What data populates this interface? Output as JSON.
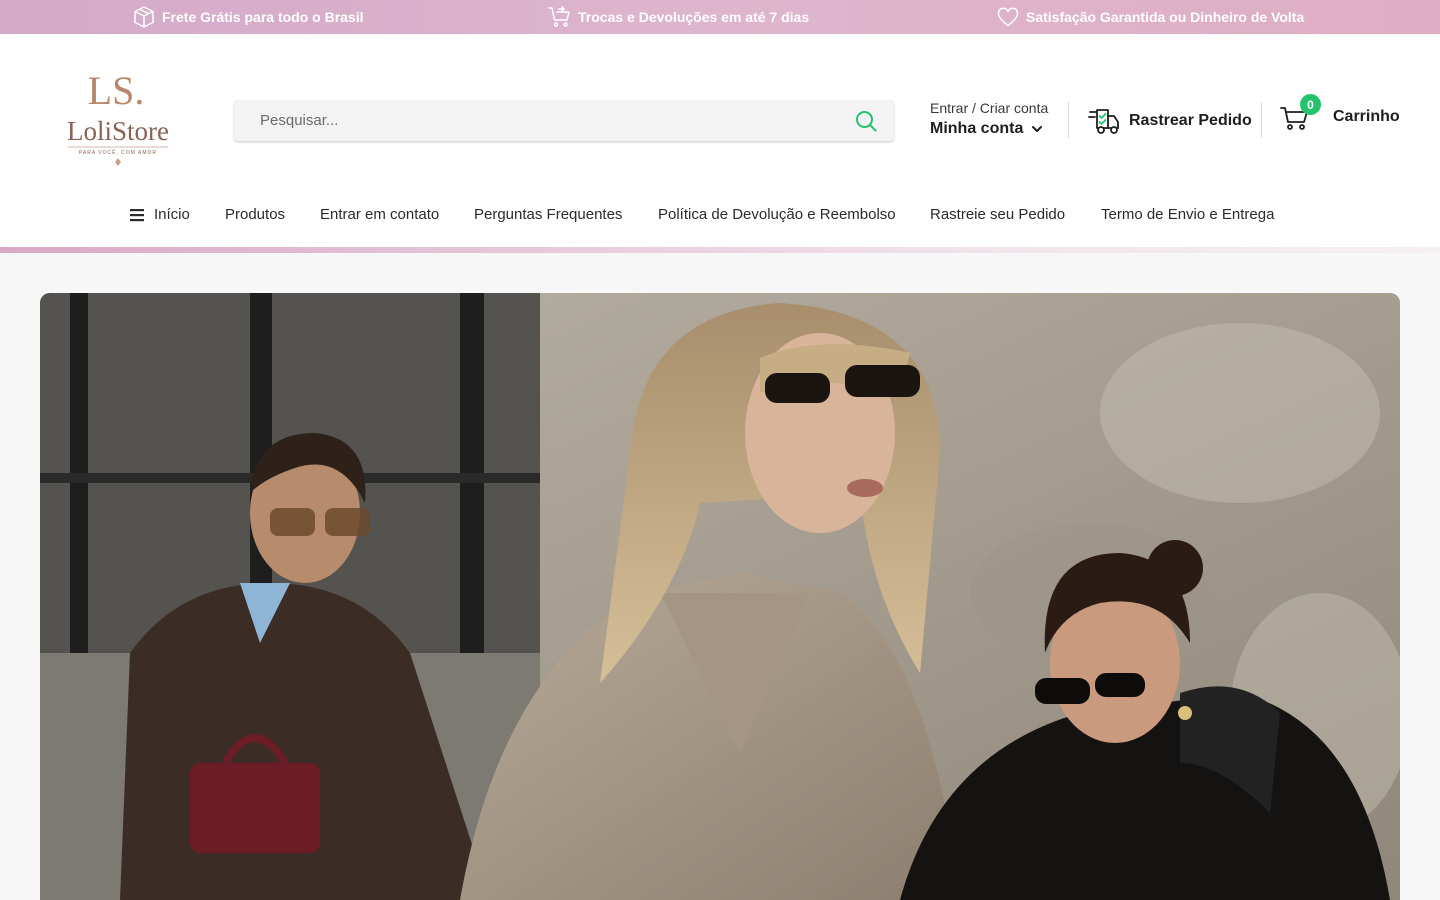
{
  "announcement": {
    "items": [
      {
        "icon": "package-icon",
        "text": "Frete Grátis para todo o Brasil"
      },
      {
        "icon": "cart-return-icon",
        "text": "Trocas e Devoluções em até 7 dias"
      },
      {
        "icon": "heart-icon",
        "text": "Satisfação Garantida ou Dinheiro de Volta"
      }
    ]
  },
  "brand": {
    "monogram": "LS.",
    "name": "LoliStore",
    "tagline": "PARA VOCÊ, COM AMOR"
  },
  "search": {
    "placeholder": "Pesquisar...",
    "value": ""
  },
  "account": {
    "line1": "Entrar / Criar conta",
    "line2": "Minha conta"
  },
  "track_order": {
    "label": "Rastrear Pedido"
  },
  "cart": {
    "count": "0",
    "label": "Carrinho"
  },
  "nav": {
    "items": [
      {
        "label": "Início"
      },
      {
        "label": "Produtos"
      },
      {
        "label": "Entrar em contato"
      },
      {
        "label": "Perguntas Frequentes"
      },
      {
        "label": "Política de Devolução e Reembolso"
      },
      {
        "label": "Rastreie seu Pedido"
      },
      {
        "label": "Termo de Envio e Entrega"
      }
    ]
  },
  "colors": {
    "announcement_bg": "#d8b0c8",
    "badge": "#23c26b",
    "search_icon": "#23c26b",
    "brand_gold": "#b8866b"
  }
}
